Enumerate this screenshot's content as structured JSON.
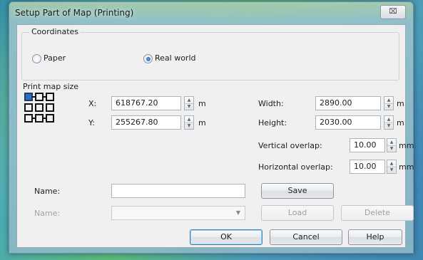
{
  "window": {
    "title": "Setup Part of Map (Printing)",
    "close_glyph": "⌧"
  },
  "coordinates": {
    "title": "Coordinates",
    "options": [
      {
        "label": "Paper",
        "checked": false
      },
      {
        "label": "Real world",
        "checked": true
      }
    ]
  },
  "print_map_size": {
    "title": "Print map size",
    "x": {
      "label": "X:",
      "value": "618767.20",
      "unit": "m"
    },
    "y": {
      "label": "Y:",
      "value": "255267.80",
      "unit": "m"
    },
    "width": {
      "label": "Width:",
      "value": "2890.00",
      "unit": "m"
    },
    "height": {
      "label": "Height:",
      "value": "2030.00",
      "unit": "m"
    },
    "vertical_overlap": {
      "label": "Vertical overlap:",
      "value": "10.00",
      "unit": "mm"
    },
    "horizontal_overlap": {
      "label": "Horizontal overlap:",
      "value": "10.00",
      "unit": "mm"
    }
  },
  "name_section": {
    "name_label": "Name:",
    "name_value": "",
    "save_label": "Save",
    "load_name_label": "Name:",
    "load_name_value": "",
    "load_label": "Load",
    "delete_label": "Delete"
  },
  "footer": {
    "ok_label": "OK",
    "cancel_label": "Cancel",
    "help_label": "Help"
  },
  "colors": {
    "accent": "#1d5fa8",
    "default_button_border": "#3c7fb1",
    "dialog_bg": "#f0f0f0"
  }
}
